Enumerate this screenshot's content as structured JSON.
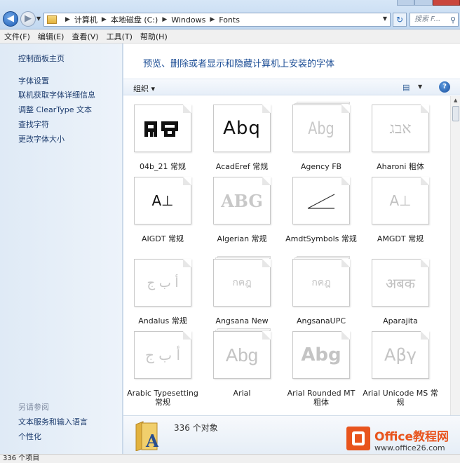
{
  "address": {
    "crumbs": [
      "计算机",
      "本地磁盘 (C:)",
      "Windows",
      "Fonts"
    ],
    "search_placeholder": "搜索 F..."
  },
  "menubar": [
    "文件(F)",
    "编辑(E)",
    "查看(V)",
    "工具(T)",
    "帮助(H)"
  ],
  "sidebar": {
    "home": "控制面板主页",
    "links": [
      "字体设置",
      "联机获取字体详细信息",
      "调整 ClearType 文本",
      "查找字符",
      "更改字体大小"
    ],
    "see_also_heading": "另请参阅",
    "see_also": [
      "文本服务和输入语言",
      "个性化"
    ]
  },
  "main": {
    "title": "预览、删除或者显示和隐藏计算机上安装的字体",
    "organize": "组织 ▾"
  },
  "fonts": [
    {
      "name": "04b_21 常规",
      "sample": "AR ",
      "style": "pixel"
    },
    {
      "name": "AcadEref 常规",
      "sample": "Abq",
      "style": "dark"
    },
    {
      "name": "Agency FB",
      "sample": "Abg",
      "style": "grey-stack"
    },
    {
      "name": "Aharoni 粗体",
      "sample": "אבג",
      "style": "grey"
    },
    {
      "name": "AIGDT 常规",
      "sample": "A⊥",
      "style": "dark"
    },
    {
      "name": "Algerian 常规",
      "sample": "ABG",
      "style": "grey"
    },
    {
      "name": "AmdtSymbols 常规",
      "sample": "∠",
      "style": "dark"
    },
    {
      "name": "AMGDT 常规",
      "sample": "A⊥",
      "style": "grey"
    },
    {
      "name": "Andalus 常规",
      "sample": "أ ب ج",
      "style": "grey"
    },
    {
      "name": "Angsana New",
      "sample": "กคฎ",
      "style": "grey-stack"
    },
    {
      "name": "AngsanaUPC",
      "sample": "กคฎ",
      "style": "grey-stack"
    },
    {
      "name": "Aparajita",
      "sample": "अबक",
      "style": "grey"
    },
    {
      "name": "Arabic Typesetting 常规",
      "sample": "أ ب ج",
      "style": "grey"
    },
    {
      "name": "Arial",
      "sample": "Abg",
      "style": "grey-stack"
    },
    {
      "name": "Arial Rounded MT 粗体",
      "sample": "Abg",
      "style": "grey-bold"
    },
    {
      "name": "Arial Unicode MS 常规",
      "sample": "Aβγ",
      "style": "grey"
    }
  ],
  "details": {
    "count": "336 个对象"
  },
  "status": "336 个项目",
  "watermark": {
    "name": "Office教程网",
    "url": "www.office26.com"
  }
}
